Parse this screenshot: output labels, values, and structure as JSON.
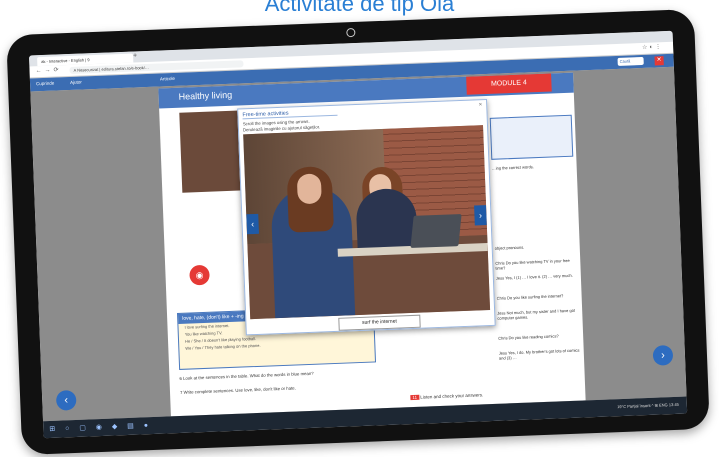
{
  "page_caption": "Activitate de tip Ola",
  "browser": {
    "tab_title": "ak - Interactive - English | 9",
    "url": "A Nesecurizat | editura.stefan.ro/e-book/…",
    "new_tab_symbol": "+"
  },
  "app_bar": {
    "items": [
      "Cuprinde",
      "Ajutor",
      "",
      "Articole"
    ],
    "search_label": "Caută",
    "close_symbol": "✕"
  },
  "page": {
    "title": "Healthy living",
    "module": "MODULE 4",
    "grammar": {
      "title": "love, hate, (don't) like + -ing",
      "lines": [
        "I love surfing the internet.",
        "You like watching TV.",
        "He / She / It doesn't like playing football.",
        "We / You / They hate talking on the phone."
      ]
    },
    "exercise6": "6  Look at the sentences in the table. What do the words in blue mean?",
    "exercise7": "7  Write complete sentences. Use love, like, don't like or hate.",
    "right_texts": [
      "…ing the correct words.",
      "object pronouns.",
      "Chris  Do you like watching TV in your free time?",
      "Jess   Yes, I (1) … I love it. (2) … very much.",
      "Chris  Do you like surfing the internet?",
      "Jess   Not much, but my sister and I have got computer games.",
      "Chris  Do you like reading comics?",
      "Jess   Yes, I do. My brother's got lots of comics and (3) …"
    ],
    "listen_num": "11",
    "listen_text": "Listen and check your answers."
  },
  "popup": {
    "title": "Free-time activities",
    "close_symbol": "×",
    "instructions": [
      "Scroll the images using the arrows.",
      "Derulează imaginile cu ajutorul săgeților."
    ],
    "image_caption": "surf the internet",
    "prev_symbol": "‹",
    "next_symbol": "›"
  },
  "navigation": {
    "prev": "‹",
    "next": "›"
  },
  "taskbar": {
    "icons": "⊞ ○ ▢ ◉ ◆ ▤ ●",
    "tray": "19°C  Parțial însorit  ^  ⊞  ENG  13:45"
  }
}
